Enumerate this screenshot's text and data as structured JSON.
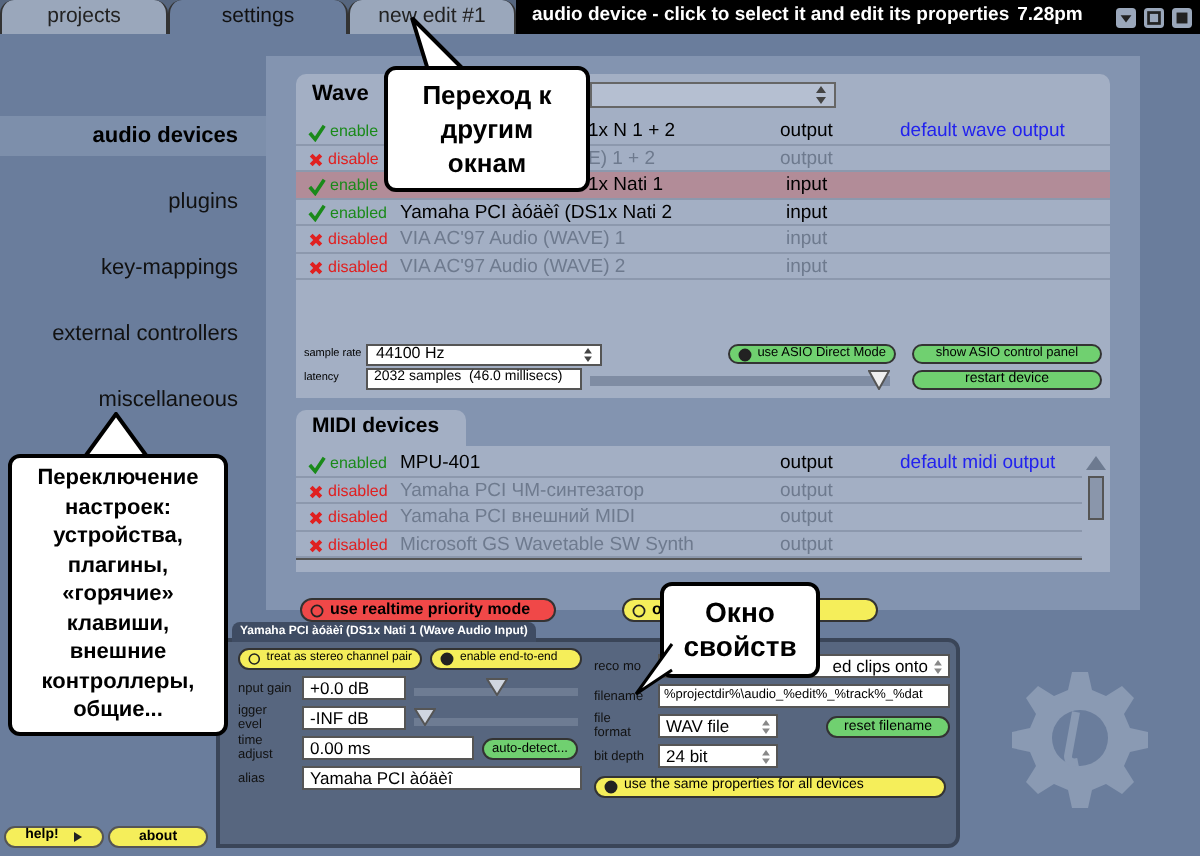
{
  "tabs": [
    {
      "label": "projects",
      "selected": false
    },
    {
      "label": "settings",
      "selected": true
    },
    {
      "label": "new edit #1",
      "selected": false
    }
  ],
  "title_bar": {
    "text": "audio device - click to select it and edit its properties",
    "time": "7.28pm"
  },
  "sidebar": {
    "items": [
      {
        "label": "audio devices",
        "selected": true
      },
      {
        "label": "plugins",
        "selected": false
      },
      {
        "label": "key-mappings",
        "selected": false
      },
      {
        "label": "external controllers",
        "selected": false
      },
      {
        "label": "miscellaneous",
        "selected": false
      }
    ]
  },
  "wave_devices": {
    "title": "Wave",
    "rows": [
      {
        "enabled": true,
        "status": "enable",
        "name": "1x N 1 + 2",
        "direction": "output",
        "default": "default wave output",
        "selected": false,
        "covered": true
      },
      {
        "enabled": false,
        "status": "disable",
        "name": "E) 1 + 2",
        "direction": "output",
        "selected": false,
        "covered": true
      },
      {
        "enabled": true,
        "status": "enable",
        "name": "1x Nati 1",
        "direction": "input",
        "selected": true,
        "covered": true
      },
      {
        "enabled": true,
        "status": "enabled",
        "name": "Yamaha PCI àóäèî (DS1x Nati 2",
        "direction": "input",
        "selected": false,
        "covered": false
      },
      {
        "enabled": false,
        "status": "disabled",
        "name": "VIA AC'97 Audio (WAVE) 1",
        "direction": "input",
        "selected": false,
        "covered": false
      },
      {
        "enabled": false,
        "status": "disabled",
        "name": "VIA AC'97 Audio (WAVE) 2",
        "direction": "input",
        "selected": false,
        "covered": false
      }
    ],
    "sample_rate": {
      "label": "sample rate",
      "value": "44100 Hz"
    },
    "latency": {
      "label": "latency",
      "value": "2032 samples  (46.0 millisecs)",
      "level": 1
    },
    "asio_direct": {
      "label": "use ASIO Direct Mode",
      "checked": true
    },
    "buttons": [
      "show ASIO control panel",
      "restart device"
    ]
  },
  "midi_devices": {
    "title": "MIDI devices",
    "rows": [
      {
        "enabled": true,
        "status": "enabled",
        "name": "MPU-401",
        "direction": "output",
        "default": "default midi output",
        "selected": false,
        "covered": false
      },
      {
        "enabled": false,
        "status": "disabled",
        "name": "Yamaha PCI ЧМ-синтезатор",
        "direction": "output",
        "selected": false,
        "covered": false
      },
      {
        "enabled": false,
        "status": "disabled",
        "name": "Yamaha PCI внешний MIDI",
        "direction": "output",
        "selected": false,
        "covered": false
      },
      {
        "enabled": false,
        "status": "disabled",
        "name": "Microsoft GS Wavetable SW Synth",
        "direction": "output",
        "selected": false,
        "covered": false
      }
    ]
  },
  "options": [
    {
      "label": "use realtime priority mode",
      "color": "#f04848",
      "checked": false
    },
    {
      "label": "o",
      "color": "#f5ee5a",
      "checked": false
    }
  ],
  "properties": {
    "title": "Yamaha PCI àóäèî (DS1x Nati 1 (Wave Audio Input)",
    "toggles": [
      {
        "label": "treat as stereo channel pair",
        "checked": false
      },
      {
        "label": "enable end-to-end",
        "checked": true
      }
    ],
    "input_gain": {
      "label": "nput gain",
      "value": "+0.0 dB",
      "level": 0.5
    },
    "trigger_level": {
      "label": "igger evel",
      "value": "-INF dB",
      "level": 0
    },
    "time_adjust": {
      "label": "time adjust",
      "value": "0.00 ms",
      "button": "auto-detect..."
    },
    "alias": {
      "label": "alias",
      "value": "Yamaha PCI àóäèî"
    },
    "record_mode": {
      "label": "reco mo",
      "value": "ed clips onto"
    },
    "filename": {
      "label": "filename",
      "value": "%projectdir%\\audio_%edit%_%track%_%dat"
    },
    "file_format": {
      "label": "file format",
      "value": "WAV file"
    },
    "reset_button": "reset filename",
    "bit_depth": {
      "label": "bit depth",
      "value": "24 bit"
    },
    "same_for_all": {
      "label": "use the same properties for all devices",
      "checked": true
    }
  },
  "footer_buttons": [
    "help!",
    "about"
  ],
  "callouts": [
    "Переход к другим окнам",
    "Переключение настроек: устройства, плагины, «горячие» клавиши, внешние контроллеры, общие...",
    "Окно свойств"
  ]
}
